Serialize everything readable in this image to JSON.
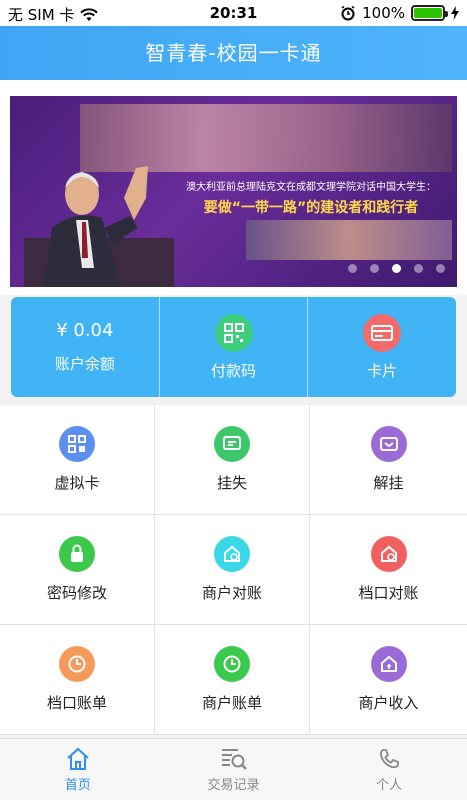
{
  "status_bar": {
    "carrier": "无 SIM 卡",
    "time": "20:31",
    "battery": "100%",
    "battery_level": 1.0
  },
  "header": {
    "title": "智青春-校园一卡通"
  },
  "banner": {
    "subtitle": "澳大利亚前总理陆克文在成都文理学院对话中国大学生：",
    "headline": "要做“一带一路”的建设者和践行者",
    "dots_total": 5,
    "dots_active_index": 2
  },
  "panel": {
    "balance_value": "¥ 0.04",
    "balance_label": "账户余额",
    "pay_code_label": "付款码",
    "card_label": "卡片"
  },
  "grid": {
    "items": [
      {
        "label": "虚拟卡",
        "icon": "qr-card-icon",
        "color": "#5c8ff0"
      },
      {
        "label": "挂失",
        "icon": "report-lost-icon",
        "color": "#3cc86a"
      },
      {
        "label": "解挂",
        "icon": "unfreeze-icon",
        "color": "#9a6ad6"
      },
      {
        "label": "密码修改",
        "icon": "lock-icon",
        "color": "#3cc84a"
      },
      {
        "label": "商户对账",
        "icon": "merchant-reconcile-icon",
        "color": "#3ad7e6"
      },
      {
        "label": "档口对账",
        "icon": "stall-reconcile-icon",
        "color": "#f06060"
      },
      {
        "label": "档口账单",
        "icon": "stall-bill-clock-icon",
        "color": "#f59a5a"
      },
      {
        "label": "商户账单",
        "icon": "merchant-bill-clock-icon",
        "color": "#3cc84a"
      },
      {
        "label": "商户收入",
        "icon": "merchant-income-icon",
        "color": "#9a6ad6"
      }
    ]
  },
  "tabbar": {
    "home": "首页",
    "transactions": "交易记录",
    "profile": "个人",
    "active_color": "#2f8ff0"
  }
}
